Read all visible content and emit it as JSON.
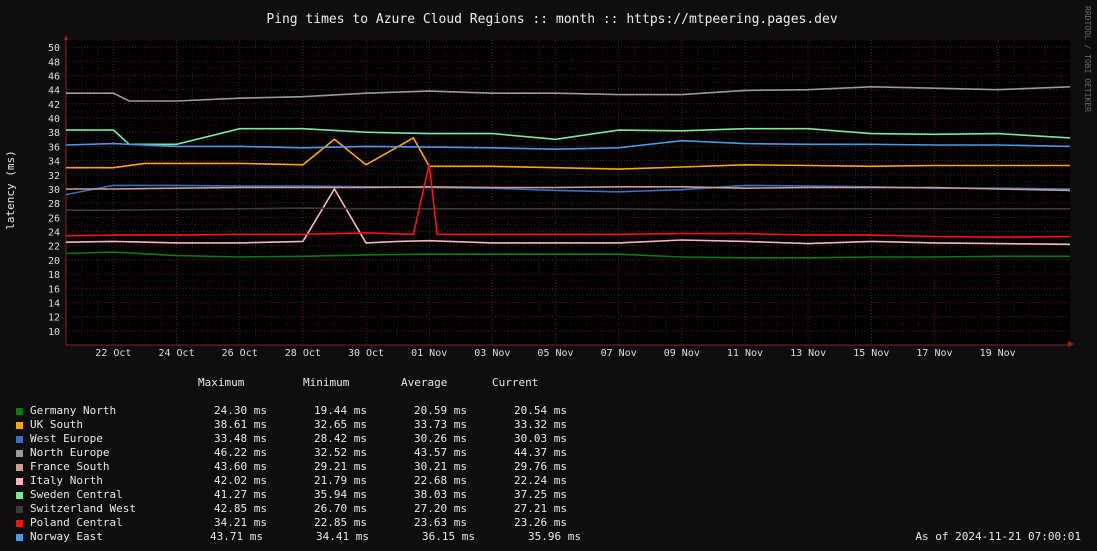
{
  "chart_data": {
    "type": "line",
    "title": "Ping times to Azure Cloud Regions :: month :: https://mtpeering.pages.dev",
    "ylabel": "latency (ms)",
    "xlabel": "",
    "ylim": [
      8,
      51
    ],
    "yticks": [
      10,
      12,
      14,
      16,
      18,
      20,
      22,
      24,
      26,
      28,
      30,
      32,
      34,
      36,
      38,
      40,
      42,
      44,
      46,
      48,
      50
    ],
    "x_start": "2024-10-20T12:00",
    "x_end": "2024-11-21T07:00",
    "xticks": [
      {
        "date": "2024-10-22",
        "label": "22 Oct"
      },
      {
        "date": "2024-10-24",
        "label": "24 Oct"
      },
      {
        "date": "2024-10-26",
        "label": "26 Oct"
      },
      {
        "date": "2024-10-28",
        "label": "28 Oct"
      },
      {
        "date": "2024-10-30",
        "label": "30 Oct"
      },
      {
        "date": "2024-11-01",
        "label": "01 Nov"
      },
      {
        "date": "2024-11-03",
        "label": "03 Nov"
      },
      {
        "date": "2024-11-05",
        "label": "05 Nov"
      },
      {
        "date": "2024-11-07",
        "label": "07 Nov"
      },
      {
        "date": "2024-11-09",
        "label": "09 Nov"
      },
      {
        "date": "2024-11-11",
        "label": "11 Nov"
      },
      {
        "date": "2024-11-13",
        "label": "13 Nov"
      },
      {
        "date": "2024-11-15",
        "label": "15 Nov"
      },
      {
        "date": "2024-11-17",
        "label": "17 Nov"
      },
      {
        "date": "2024-11-19",
        "label": "19 Nov"
      }
    ],
    "grid": true,
    "series": [
      {
        "name": "Germany North",
        "color": "#0a7a0a",
        "x": [
          "2024-10-20T12:00",
          "2024-10-22T00:00",
          "2024-10-24T00:00",
          "2024-10-26T00:00",
          "2024-10-28T00:00",
          "2024-10-30T00:00",
          "2024-11-01T00:00",
          "2024-11-03T00:00",
          "2024-11-05T00:00",
          "2024-11-07T00:00",
          "2024-11-09T00:00",
          "2024-11-11T00:00",
          "2024-11-13T00:00",
          "2024-11-15T00:00",
          "2024-11-17T00:00",
          "2024-11-19T00:00",
          "2024-11-21T07:00"
        ],
        "y": [
          20.9,
          21.1,
          20.6,
          20.4,
          20.5,
          20.7,
          20.8,
          20.8,
          20.8,
          20.8,
          20.4,
          20.3,
          20.3,
          20.4,
          20.4,
          20.5,
          20.5
        ]
      },
      {
        "name": "UK South",
        "color": "#ffa500",
        "x": [
          "2024-10-20T12:00",
          "2024-10-22T00:00",
          "2024-10-23T00:00",
          "2024-10-24T00:00",
          "2024-10-26T00:00",
          "2024-10-28T00:00",
          "2024-10-29T00:00",
          "2024-10-30T00:00",
          "2024-10-31T12:00",
          "2024-11-01T00:00",
          "2024-11-03T00:00",
          "2024-11-05T00:00",
          "2024-11-07T00:00",
          "2024-11-09T00:00",
          "2024-11-11T00:00",
          "2024-11-13T00:00",
          "2024-11-15T00:00",
          "2024-11-17T00:00",
          "2024-11-19T00:00",
          "2024-11-21T07:00"
        ],
        "y": [
          33.0,
          33.0,
          33.6,
          33.6,
          33.6,
          33.4,
          37.0,
          33.4,
          37.2,
          33.2,
          33.2,
          33.0,
          32.8,
          33.1,
          33.4,
          33.3,
          33.2,
          33.3,
          33.3,
          33.3
        ]
      },
      {
        "name": "West Europe",
        "color": "#3a6fc4",
        "x": [
          "2024-10-20T12:00",
          "2024-10-22T00:00",
          "2024-10-24T00:00",
          "2024-10-26T00:00",
          "2024-10-28T00:00",
          "2024-10-30T00:00",
          "2024-11-01T00:00",
          "2024-11-03T00:00",
          "2024-11-05T00:00",
          "2024-11-07T00:00",
          "2024-11-09T00:00",
          "2024-11-11T00:00",
          "2024-11-13T00:00",
          "2024-11-15T00:00",
          "2024-11-17T00:00",
          "2024-11-19T00:00",
          "2024-11-21T07:00"
        ],
        "y": [
          29.2,
          30.5,
          30.5,
          30.4,
          30.4,
          30.3,
          30.2,
          30.1,
          29.8,
          29.6,
          29.9,
          30.5,
          30.4,
          30.3,
          30.1,
          30.1,
          30.0
        ]
      },
      {
        "name": "North Europe",
        "color": "#9a9a9a",
        "x": [
          "2024-10-20T12:00",
          "2024-10-22T00:00",
          "2024-10-22T12:00",
          "2024-10-24T00:00",
          "2024-10-26T00:00",
          "2024-10-28T00:00",
          "2024-10-30T00:00",
          "2024-11-01T00:00",
          "2024-11-03T00:00",
          "2024-11-05T00:00",
          "2024-11-07T00:00",
          "2024-11-09T00:00",
          "2024-11-11T00:00",
          "2024-11-13T00:00",
          "2024-11-15T00:00",
          "2024-11-17T00:00",
          "2024-11-19T00:00",
          "2024-11-21T07:00"
        ],
        "y": [
          43.5,
          43.5,
          42.4,
          42.4,
          42.8,
          43.0,
          43.5,
          43.8,
          43.5,
          43.5,
          43.3,
          43.3,
          43.9,
          44.0,
          44.4,
          44.2,
          44.0,
          44.4
        ]
      },
      {
        "name": "France South",
        "color": "#c8a090",
        "x": [
          "2024-10-20T12:00",
          "2024-10-22T00:00",
          "2024-10-24T00:00",
          "2024-10-26T00:00",
          "2024-10-28T00:00",
          "2024-10-30T00:00",
          "2024-11-01T00:00",
          "2024-11-03T00:00",
          "2024-11-05T00:00",
          "2024-11-07T00:00",
          "2024-11-09T00:00",
          "2024-11-11T00:00",
          "2024-11-13T00:00",
          "2024-11-15T00:00",
          "2024-11-17T00:00",
          "2024-11-19T00:00",
          "2024-11-21T07:00"
        ],
        "y": [
          30.0,
          30.0,
          30.1,
          30.2,
          30.2,
          30.2,
          30.3,
          30.2,
          30.2,
          30.3,
          30.3,
          30.1,
          30.2,
          30.2,
          30.2,
          30.0,
          29.8
        ]
      },
      {
        "name": "Italy North",
        "color": "#f4b8c0",
        "x": [
          "2024-10-20T12:00",
          "2024-10-22T00:00",
          "2024-10-24T00:00",
          "2024-10-26T00:00",
          "2024-10-28T00:00",
          "2024-10-29T00:00",
          "2024-10-30T00:00",
          "2024-10-31T00:00",
          "2024-11-01T00:00",
          "2024-11-03T00:00",
          "2024-11-05T00:00",
          "2024-11-07T00:00",
          "2024-11-09T00:00",
          "2024-11-11T00:00",
          "2024-11-13T00:00",
          "2024-11-15T00:00",
          "2024-11-17T00:00",
          "2024-11-19T00:00",
          "2024-11-21T07:00"
        ],
        "y": [
          22.5,
          22.6,
          22.4,
          22.4,
          22.6,
          30.0,
          22.4,
          22.6,
          22.7,
          22.4,
          22.4,
          22.4,
          22.8,
          22.6,
          22.3,
          22.6,
          22.4,
          22.3,
          22.2
        ]
      },
      {
        "name": "Sweden Central",
        "color": "#7ce89a",
        "x": [
          "2024-10-20T12:00",
          "2024-10-22T00:00",
          "2024-10-22T12:00",
          "2024-10-24T00:00",
          "2024-10-26T00:00",
          "2024-10-28T00:00",
          "2024-10-30T00:00",
          "2024-11-01T00:00",
          "2024-11-03T00:00",
          "2024-11-05T00:00",
          "2024-11-07T00:00",
          "2024-11-09T00:00",
          "2024-11-11T00:00",
          "2024-11-13T00:00",
          "2024-11-15T00:00",
          "2024-11-17T00:00",
          "2024-11-19T00:00",
          "2024-11-21T07:00"
        ],
        "y": [
          38.3,
          38.3,
          36.3,
          36.3,
          38.5,
          38.5,
          38.0,
          37.8,
          37.8,
          37.0,
          38.3,
          38.2,
          38.5,
          38.5,
          37.8,
          37.7,
          37.8,
          37.2
        ]
      },
      {
        "name": "Switzerland West",
        "color": "#3a3a3a",
        "x": [
          "2024-10-20T12:00",
          "2024-10-22T00:00",
          "2024-10-24T00:00",
          "2024-10-26T00:00",
          "2024-10-28T00:00",
          "2024-10-30T00:00",
          "2024-11-01T00:00",
          "2024-11-03T00:00",
          "2024-11-05T00:00",
          "2024-11-07T00:00",
          "2024-11-09T00:00",
          "2024-11-11T00:00",
          "2024-11-13T00:00",
          "2024-11-15T00:00",
          "2024-11-17T00:00",
          "2024-11-19T00:00",
          "2024-11-21T07:00"
        ],
        "y": [
          27.0,
          27.0,
          27.1,
          27.2,
          27.3,
          27.2,
          27.2,
          27.2,
          27.2,
          27.2,
          27.1,
          27.1,
          27.2,
          27.2,
          27.2,
          27.2,
          27.2
        ]
      },
      {
        "name": "Poland Central",
        "color": "#ff1010",
        "x": [
          "2024-10-20T12:00",
          "2024-10-22T00:00",
          "2024-10-24T00:00",
          "2024-10-26T00:00",
          "2024-10-28T00:00",
          "2024-10-30T00:00",
          "2024-10-31T12:00",
          "2024-11-01T00:00",
          "2024-11-01T06:00",
          "2024-11-03T00:00",
          "2024-11-05T00:00",
          "2024-11-07T00:00",
          "2024-11-09T00:00",
          "2024-11-11T00:00",
          "2024-11-13T00:00",
          "2024-11-15T00:00",
          "2024-11-17T00:00",
          "2024-11-19T00:00",
          "2024-11-21T07:00"
        ],
        "y": [
          23.4,
          23.5,
          23.5,
          23.6,
          23.6,
          23.8,
          23.6,
          33.5,
          23.6,
          23.6,
          23.6,
          23.6,
          23.7,
          23.7,
          23.5,
          23.5,
          23.3,
          23.2,
          23.3
        ]
      },
      {
        "name": "Norway East",
        "color": "#4a9ae6",
        "x": [
          "2024-10-20T12:00",
          "2024-10-22T00:00",
          "2024-10-24T00:00",
          "2024-10-26T00:00",
          "2024-10-28T00:00",
          "2024-10-30T00:00",
          "2024-11-01T00:00",
          "2024-11-03T00:00",
          "2024-11-05T00:00",
          "2024-11-07T00:00",
          "2024-11-09T00:00",
          "2024-11-11T00:00",
          "2024-11-13T00:00",
          "2024-11-15T00:00",
          "2024-11-17T00:00",
          "2024-11-19T00:00",
          "2024-11-21T07:00"
        ],
        "y": [
          36.2,
          36.4,
          36.0,
          36.0,
          35.8,
          36.0,
          35.9,
          35.8,
          35.6,
          35.8,
          36.8,
          36.4,
          36.3,
          36.3,
          36.2,
          36.2,
          36.0
        ]
      }
    ],
    "stats_headers": [
      "Maximum",
      "Minimum",
      "Average",
      "Current"
    ],
    "stats": [
      {
        "name": "Germany North",
        "values": [
          "24.30 ms",
          "19.44 ms",
          "20.59 ms",
          "20.54 ms"
        ]
      },
      {
        "name": "UK South",
        "values": [
          "38.61 ms",
          "32.65 ms",
          "33.73 ms",
          "33.32 ms"
        ]
      },
      {
        "name": "West Europe",
        "values": [
          "33.48 ms",
          "28.42 ms",
          "30.26 ms",
          "30.03 ms"
        ]
      },
      {
        "name": "North Europe",
        "values": [
          "46.22 ms",
          "32.52 ms",
          "43.57 ms",
          "44.37 ms"
        ]
      },
      {
        "name": "France South",
        "values": [
          "43.60 ms",
          "29.21 ms",
          "30.21 ms",
          "29.76 ms"
        ]
      },
      {
        "name": "Italy North",
        "values": [
          "42.02 ms",
          "21.79 ms",
          "22.68 ms",
          "22.24 ms"
        ]
      },
      {
        "name": "Sweden Central",
        "values": [
          "41.27 ms",
          "35.94 ms",
          "38.03 ms",
          "37.25 ms"
        ]
      },
      {
        "name": "Switzerland West",
        "values": [
          "42.85 ms",
          "26.70 ms",
          "27.20 ms",
          "27.21 ms"
        ]
      },
      {
        "name": "Poland Central",
        "values": [
          "34.21 ms",
          "22.85 ms",
          "23.63 ms",
          "23.26 ms"
        ]
      },
      {
        "name": "Norway East",
        "values": [
          "43.71 ms",
          "34.41 ms",
          "36.15 ms",
          "35.96 ms"
        ]
      }
    ],
    "watermark": "RRDTOOL / TOBI OETIKER",
    "as_of": "As of 2024-11-21 07:00:01"
  },
  "colors": {
    "background": "#0e0e0e",
    "canvas": "#000000",
    "grid_major": "#5a2020",
    "grid_minor": "#2e1414",
    "font": "#e8e8e8"
  }
}
